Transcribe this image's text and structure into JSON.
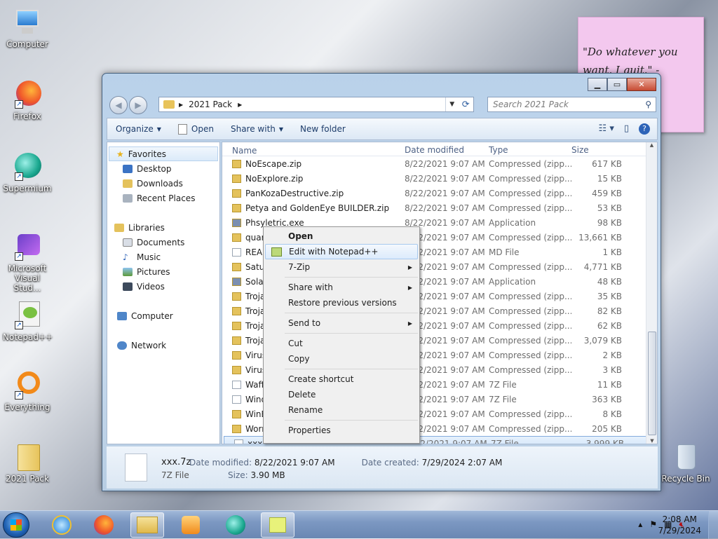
{
  "desktop": {
    "icons": [
      {
        "label": "Computer",
        "icon": "computer-icon"
      },
      {
        "label": "Firefox",
        "icon": "firefox-icon"
      },
      {
        "label": "Supermium",
        "icon": "supermium-icon"
      },
      {
        "label": "Microsoft Visual Stud...",
        "icon": "visual-studio-icon"
      },
      {
        "label": "Notepad++",
        "icon": "notepadpp-icon"
      },
      {
        "label": "Everything",
        "icon": "everything-icon"
      },
      {
        "label": "2021 Pack",
        "icon": "folder-icon"
      }
    ],
    "recycle_bin": "Recycle Bin",
    "sticky_note": "\"Do whatever you want. I quit.\" -"
  },
  "window": {
    "caption_buttons": [
      "minimize",
      "maximize",
      "close"
    ],
    "address": "2021 Pack",
    "search_placeholder": "Search 2021 Pack",
    "toolbar": {
      "organize": "Organize",
      "open": "Open",
      "share_with": "Share with",
      "new_folder": "New folder"
    },
    "nav": {
      "favorites": "Favorites",
      "favorites_items": [
        "Desktop",
        "Downloads",
        "Recent Places"
      ],
      "libraries": "Libraries",
      "libraries_items": [
        "Documents",
        "Music",
        "Pictures",
        "Videos"
      ],
      "computer": "Computer",
      "network": "Network"
    },
    "columns": {
      "name": "Name",
      "date": "Date modified",
      "type": "Type",
      "size": "Size"
    },
    "files": [
      {
        "name": "NoEscape.zip",
        "date": "8/22/2021 9:07 AM",
        "type": "Compressed (zipp...",
        "size": "617 KB",
        "kind": "zip"
      },
      {
        "name": "NoExplore.zip",
        "date": "8/22/2021 9:07 AM",
        "type": "Compressed (zipp...",
        "size": "15 KB",
        "kind": "zip"
      },
      {
        "name": "PanKozaDestructive.zip",
        "date": "8/22/2021 9:07 AM",
        "type": "Compressed (zipp...",
        "size": "459 KB",
        "kind": "zip"
      },
      {
        "name": "Petya and GoldenEye BUILDER.zip",
        "date": "8/22/2021 9:07 AM",
        "type": "Compressed (zipp...",
        "size": "53 KB",
        "kind": "zip"
      },
      {
        "name": "Phsyletric.exe",
        "date": "8/22/2021 9:07 AM",
        "type": "Application",
        "size": "98 KB",
        "kind": "exe"
      },
      {
        "name": "quar",
        "date": "8/22/2021 9:07 AM",
        "type": "Compressed (zipp...",
        "size": "13,661 KB",
        "kind": "zip"
      },
      {
        "name": "READ",
        "date": "8/22/2021 9:07 AM",
        "type": "MD File",
        "size": "1 KB",
        "kind": "file"
      },
      {
        "name": "Satur",
        "date": "8/22/2021 9:07 AM",
        "type": "Compressed (zipp...",
        "size": "4,771 KB",
        "kind": "zip"
      },
      {
        "name": "Solar",
        "date": "8/22/2021 9:07 AM",
        "type": "Application",
        "size": "48 KB",
        "kind": "exe"
      },
      {
        "name": "Troja",
        "date": "8/22/2021 9:07 AM",
        "type": "Compressed (zipp...",
        "size": "35 KB",
        "kind": "zip"
      },
      {
        "name": "Troja",
        "date": "8/22/2021 9:07 AM",
        "type": "Compressed (zipp...",
        "size": "82 KB",
        "kind": "zip"
      },
      {
        "name": "Troja",
        "date": "8/22/2021 9:07 AM",
        "type": "Compressed (zipp...",
        "size": "62 KB",
        "kind": "zip"
      },
      {
        "name": "Troja",
        "date": "8/22/2021 9:07 AM",
        "type": "Compressed (zipp...",
        "size": "3,079 KB",
        "kind": "zip"
      },
      {
        "name": "Virus",
        "date": "8/22/2021 9:07 AM",
        "type": "Compressed (zipp...",
        "size": "2 KB",
        "kind": "zip"
      },
      {
        "name": "Virus",
        "date": "8/22/2021 9:07 AM",
        "type": "Compressed (zipp...",
        "size": "3 KB",
        "kind": "zip"
      },
      {
        "name": "Waff",
        "date": "8/22/2021 9:07 AM",
        "type": "7Z File",
        "size": "11 KB",
        "kind": "file"
      },
      {
        "name": "Wind",
        "date": "8/22/2021 9:07 AM",
        "type": "7Z File",
        "size": "363 KB",
        "kind": "file"
      },
      {
        "name": "WinE",
        "date": "8/22/2021 9:07 AM",
        "type": "Compressed (zipp...",
        "size": "8 KB",
        "kind": "zip"
      },
      {
        "name": "Worr",
        "date": "8/22/2021 9:07 AM",
        "type": "Compressed (zipp...",
        "size": "205 KB",
        "kind": "zip"
      },
      {
        "name": "xxx.7z",
        "date": "8/22/2021 9:07 AM",
        "type": "7Z File",
        "size": "3,999 KB",
        "kind": "file"
      }
    ],
    "details": {
      "name": "xxx.7z",
      "type": "7Z File",
      "modified_label": "Date modified:",
      "modified": "8/22/2021 9:07 AM",
      "created_label": "Date created:",
      "created": "7/29/2024 2:07 AM",
      "size_label": "Size:",
      "size": "3.90 MB"
    }
  },
  "context_menu": {
    "open": "Open",
    "edit_npp": "Edit with Notepad++",
    "seven_zip": "7-Zip",
    "share_with": "Share with",
    "restore": "Restore previous versions",
    "send_to": "Send to",
    "cut": "Cut",
    "copy": "Copy",
    "create_shortcut": "Create shortcut",
    "delete": "Delete",
    "rename": "Rename",
    "properties": "Properties"
  },
  "taskbar": {
    "pinned": [
      "internet-explorer-icon",
      "firefox-icon",
      "explorer-icon",
      "media-player-icon",
      "supermium-icon",
      "sticky-notes-icon"
    ],
    "time": "2:08 AM",
    "date": "7/29/2024"
  },
  "colors": {
    "selection": "#cfe3fa",
    "menu_bg": "#f0f0f0",
    "sticky": "#f3c8ee"
  }
}
